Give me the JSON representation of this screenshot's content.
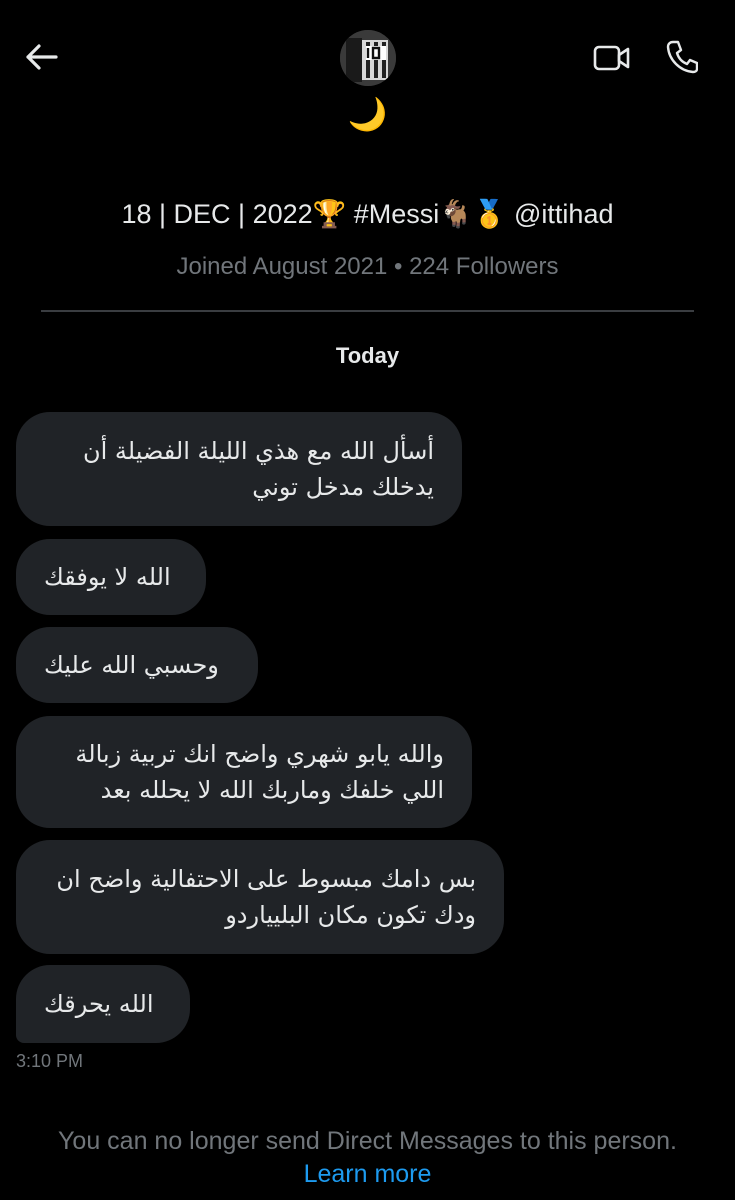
{
  "header": {
    "display_name": "🌙"
  },
  "profile": {
    "bio": "18 | DEC | 2022🏆 #Messi🐐🥇 @ittihad",
    "meta": "Joined August 2021 • 224 Followers"
  },
  "conversation": {
    "day_label": "Today",
    "messages": [
      "أسأل الله مع هذي الليلة الفضيلة أن يدخلك مدخل توني",
      "الله لا يوفقك",
      "وحسبي الله عليك",
      "والله يابو شهري واضح انك تربية زبالة اللي خلفك وماربك الله لا يحلله بعد",
      "بس دامك مبسوط على الاحتفالية واضح ان ودك تكون مكان البليياردو",
      "الله يحرقك"
    ],
    "timestamp": "3:10 PM"
  },
  "footer": {
    "notice": "You can no longer send Direct Messages to this person.",
    "learn_more": "Learn more"
  },
  "colors": {
    "background": "#000000",
    "bubble": "#202327",
    "text": "#e7e9ea",
    "muted": "#71767b",
    "link": "#1d9bf0"
  }
}
